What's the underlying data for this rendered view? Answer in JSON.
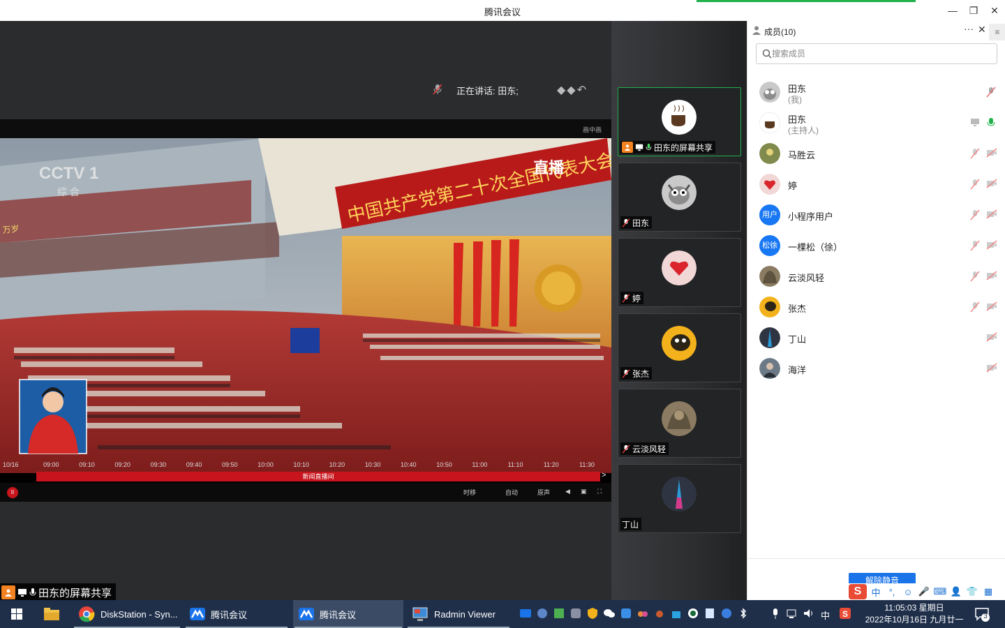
{
  "window": {
    "title": "腾讯会议",
    "minimize": "—",
    "maximize": "❐",
    "close": "✕"
  },
  "meeting": {
    "speaking_text": "正在讲话: 田东;"
  },
  "video": {
    "pip_label": "画中画",
    "channel_logo": "CCTV 1",
    "channel_sub": "综 合",
    "live_label": "直播",
    "banner_text": "中国共产党第二十次全国代表大会",
    "left_banner": "万岁",
    "timeline_times": [
      "09:00",
      "09:10",
      "09:20",
      "09:30",
      "09:40",
      "09:50",
      "10:00",
      "10:10",
      "10:20",
      "10:30",
      "10:40",
      "10:50",
      "11:00",
      "11:10",
      "11:20",
      "11:30"
    ],
    "date_left": "10/16",
    "program_label": "新闻直播间",
    "controls": {
      "timeshift": "时移",
      "auto": "自动",
      "mute": "原声"
    }
  },
  "share_label": "田东的屏幕共享",
  "tiles": [
    {
      "name": "田东的屏幕共享",
      "avatar": "coffee-logo",
      "active": true
    },
    {
      "name": "田东",
      "avatar": "gray-wolf"
    },
    {
      "name": "婷",
      "avatar": "heart-hands"
    },
    {
      "name": "张杰",
      "avatar": "yellow-cartoon"
    },
    {
      "name": "云淡风轻",
      "avatar": "lion-statue"
    },
    {
      "name": "丁山",
      "avatar": "tower-night"
    }
  ],
  "members_panel": {
    "title": "成员(10)",
    "search_placeholder": "搜索成员",
    "members": [
      {
        "name": "田东",
        "role": "(我)",
        "avatar": "gray-wolf",
        "mic": "muted",
        "video": "none"
      },
      {
        "name": "田东",
        "role": "(主持人)",
        "avatar": "coffee-logo",
        "mic": "on",
        "video": "screen"
      },
      {
        "name": "马胜云",
        "avatar": "flower",
        "mic": "muted",
        "video": "off"
      },
      {
        "name": "婷",
        "avatar": "heart-hands",
        "mic": "muted",
        "video": "off"
      },
      {
        "name": "小程序用户",
        "avatar_text": "用户",
        "mic": "muted",
        "video": "off"
      },
      {
        "name": "一棵松（徐）",
        "avatar_text": "松徐",
        "mic": "muted",
        "video": "off"
      },
      {
        "name": "云淡风轻",
        "avatar": "lion-statue",
        "mic": "muted",
        "video": "off"
      },
      {
        "name": "张杰",
        "avatar": "yellow-cartoon",
        "mic": "muted",
        "video": "off"
      },
      {
        "name": "丁山",
        "avatar": "tower-night",
        "mic": "none",
        "video": "off"
      },
      {
        "name": "海洋",
        "avatar": "portrait",
        "mic": "none",
        "video": "off"
      }
    ],
    "unmute_all": "解除静音"
  },
  "ime": {
    "logo": "S",
    "mode": "中"
  },
  "taskbar": {
    "apps": [
      {
        "label": "DiskStation - Syn...",
        "icon": "chrome-icon"
      },
      {
        "label": "腾讯会议",
        "icon": "tencent-meeting-icon"
      },
      {
        "label": "腾讯会议",
        "icon": "tencent-meeting-icon",
        "active": true
      },
      {
        "label": "Radmin Viewer",
        "icon": "radmin-icon"
      }
    ],
    "lang": "中",
    "time": "11:05:03 星期日",
    "date": "2022年10月16日 九月廿一",
    "notifications": "3"
  },
  "colors": {
    "accent": "#1a73e8",
    "active_border": "#22b14c",
    "cctv_red": "#c8151d",
    "taskbar": "#1f2f4a"
  }
}
